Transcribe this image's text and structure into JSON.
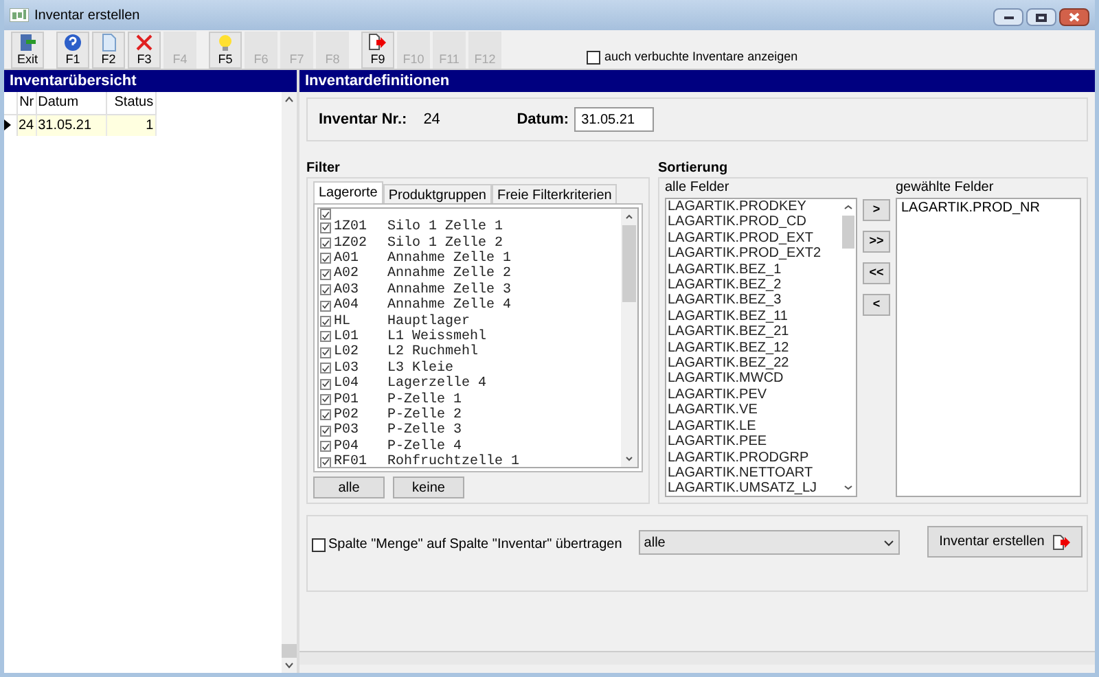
{
  "window": {
    "title": "Inventar erstellen"
  },
  "toolbar": {
    "buttons": [
      {
        "label": "Exit",
        "kind": "exit",
        "disabled": false
      },
      {
        "label": "F1",
        "kind": "help",
        "disabled": false
      },
      {
        "label": "F2",
        "kind": "page",
        "disabled": false
      },
      {
        "label": "F3",
        "kind": "delete",
        "disabled": false
      },
      {
        "label": "F4",
        "kind": "none",
        "disabled": true
      },
      {
        "label": "F5",
        "kind": "bulb",
        "disabled": false
      },
      {
        "label": "F6",
        "kind": "none",
        "disabled": true
      },
      {
        "label": "F7",
        "kind": "none",
        "disabled": true
      },
      {
        "label": "F8",
        "kind": "none",
        "disabled": true
      },
      {
        "label": "F9",
        "kind": "export",
        "disabled": false
      },
      {
        "label": "F10",
        "kind": "none",
        "disabled": true
      },
      {
        "label": "F11",
        "kind": "none",
        "disabled": true
      },
      {
        "label": "F12",
        "kind": "none",
        "disabled": true
      }
    ],
    "show_booked": {
      "label": "auch verbuchte Inventare anzeigen",
      "checked": false
    }
  },
  "overview": {
    "title": "Inventarübersicht",
    "columns": [
      "Nr",
      "Datum",
      "Status"
    ],
    "rows": [
      {
        "cells": [
          "24",
          "31.05.21",
          "1"
        ],
        "selected": true
      }
    ]
  },
  "definitions": {
    "title": "Inventardefinitionen",
    "number_label": "Inventar Nr.:",
    "number": "24",
    "date_label": "Datum:",
    "date": "31.05.21"
  },
  "filter": {
    "title": "Filter",
    "tabs": [
      {
        "label": "Lagerorte",
        "selected": true
      },
      {
        "label": "Produktgruppen",
        "selected": false
      },
      {
        "label": "Freie Filterkriterien",
        "selected": false
      }
    ],
    "items": [
      {
        "checked": true
      },
      {
        "code": "1Z01",
        "name": "Silo 1 Zelle 1",
        "checked": true
      },
      {
        "code": "1Z02",
        "name": "Silo 1 Zelle 2",
        "checked": true
      },
      {
        "code": "A01",
        "name": "Annahme Zelle 1",
        "checked": true
      },
      {
        "code": "A02",
        "name": "Annahme Zelle 2",
        "checked": true
      },
      {
        "code": "A03",
        "name": "Annahme Zelle 3",
        "checked": true
      },
      {
        "code": "A04",
        "name": "Annahme Zelle 4",
        "checked": true
      },
      {
        "code": "HL",
        "name": "Hauptlager",
        "checked": true
      },
      {
        "code": "L01",
        "name": "L1 Weissmehl",
        "checked": true
      },
      {
        "code": "L02",
        "name": "L2 Ruchmehl",
        "checked": true
      },
      {
        "code": "L03",
        "name": "L3 Kleie",
        "checked": true
      },
      {
        "code": "L04",
        "name": "Lagerzelle 4",
        "checked": true
      },
      {
        "code": "P01",
        "name": "P-Zelle 1",
        "checked": true
      },
      {
        "code": "P02",
        "name": "P-Zelle 2",
        "checked": true
      },
      {
        "code": "P03",
        "name": "P-Zelle 3",
        "checked": true
      },
      {
        "code": "P04",
        "name": "P-Zelle 4",
        "checked": true
      },
      {
        "code": "RF01",
        "name": "Rohfruchtzelle 1",
        "checked": true
      }
    ],
    "buttons": [
      "alle",
      "keine"
    ]
  },
  "sorting": {
    "title": "Sortierung",
    "available_label": "alle Felder",
    "available": [
      "LAGARTIK.PRODKEY",
      "LAGARTIK.PROD_CD",
      "LAGARTIK.PROD_EXT",
      "LAGARTIK.PROD_EXT2",
      "LAGARTIK.BEZ_1",
      "LAGARTIK.BEZ_2",
      "LAGARTIK.BEZ_3",
      "LAGARTIK.BEZ_11",
      "LAGARTIK.BEZ_21",
      "LAGARTIK.BEZ_12",
      "LAGARTIK.BEZ_22",
      "LAGARTIK.MWCD",
      "LAGARTIK.PEV",
      "LAGARTIK.VE",
      "LAGARTIK.LE",
      "LAGARTIK.PEE",
      "LAGARTIK.PRODGRP",
      "LAGARTIK.NETTOART",
      "LAGARTIK.UMSATZ_LJ"
    ],
    "move_buttons": [
      ">",
      ">>",
      "<<",
      "<"
    ],
    "chosen_label": "gewählte Felder",
    "chosen": [
      "LAGARTIK.PROD_NR"
    ]
  },
  "transfer": {
    "label": "Spalte \"Menge\" auf Spalte \"Inventar\" übertragen",
    "checked": false,
    "option": "alle"
  },
  "create_button": {
    "label": "Inventar erstellen"
  }
}
